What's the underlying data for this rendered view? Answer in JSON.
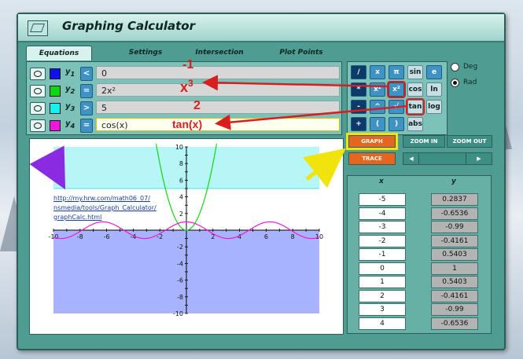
{
  "window": {
    "title": "Graphing Calculator"
  },
  "tabs": [
    {
      "label": "Equations",
      "active": true
    },
    {
      "label": "Settings"
    },
    {
      "label": "Intersection"
    },
    {
      "label": "Plot Points"
    }
  ],
  "equations": [
    {
      "label": "y",
      "sub": "1",
      "color": "#1010e8",
      "relation": "<",
      "value": "0"
    },
    {
      "label": "y",
      "sub": "2",
      "color": "#13d613",
      "relation": "=",
      "value": "2x²"
    },
    {
      "label": "y",
      "sub": "3",
      "color": "#18f0f0",
      "relation": ">",
      "value": "5"
    },
    {
      "label": "y",
      "sub": "4",
      "color": "#f018d8",
      "relation": "=",
      "value": "cos(x)"
    }
  ],
  "keypad": [
    [
      "/",
      "x",
      "π",
      "sin",
      "e"
    ],
    [
      "*",
      "x²",
      "x²",
      "cos",
      "ln"
    ],
    [
      "-",
      "^",
      "√",
      "tan",
      "log"
    ],
    [
      "+",
      "(",
      ")",
      "abs"
    ]
  ],
  "angle_mode": {
    "deg": "Deg",
    "rad": "Rad",
    "selected": "Rad"
  },
  "buttons": {
    "graph": "GRAPH",
    "trace": "TRACE",
    "zoom_in": "ZOOM IN",
    "zoom_out": "ZOOM OUT",
    "left": "◀",
    "right": "▶"
  },
  "url": [
    "http://my.hrw.com/math06_07/",
    "nsmedia/tools/Graph_Calculator/",
    "graphCalc.html"
  ],
  "table": {
    "x_header": "x",
    "y_header": "y",
    "rows": [
      [
        "-5",
        "0.2837"
      ],
      [
        "-4",
        "-0.6536"
      ],
      [
        "-3",
        "-0.99"
      ],
      [
        "-2",
        "-0.4161"
      ],
      [
        "-1",
        "0.5403"
      ],
      [
        "0",
        "1"
      ],
      [
        "1",
        "0.5403"
      ],
      [
        "2",
        "-0.4161"
      ],
      [
        "3",
        "-0.99"
      ],
      [
        "4",
        "-0.6536"
      ]
    ]
  },
  "annotations": {
    "a1": "-1",
    "a2": "x",
    "a2sup": "3",
    "a3": "2",
    "a4": "tan(x)"
  },
  "chart_data": {
    "type": "line",
    "x_range": [
      -10,
      10
    ],
    "y_range": [
      -10,
      10
    ],
    "x_ticks": [
      -10,
      -8,
      -6,
      -4,
      -2,
      2,
      4,
      6,
      8,
      10
    ],
    "y_ticks": [
      -10,
      -8,
      -6,
      -4,
      -2,
      2,
      4,
      6,
      8,
      10
    ],
    "series": [
      {
        "expr": "2x²",
        "color": "#13d613"
      },
      {
        "expr": "cos(x)",
        "color": "#f018d8"
      }
    ],
    "regions": [
      {
        "expr": "y < 0",
        "color": "#a8b4ff"
      },
      {
        "expr": "y > 5",
        "color": "#b6f6f6"
      }
    ]
  }
}
